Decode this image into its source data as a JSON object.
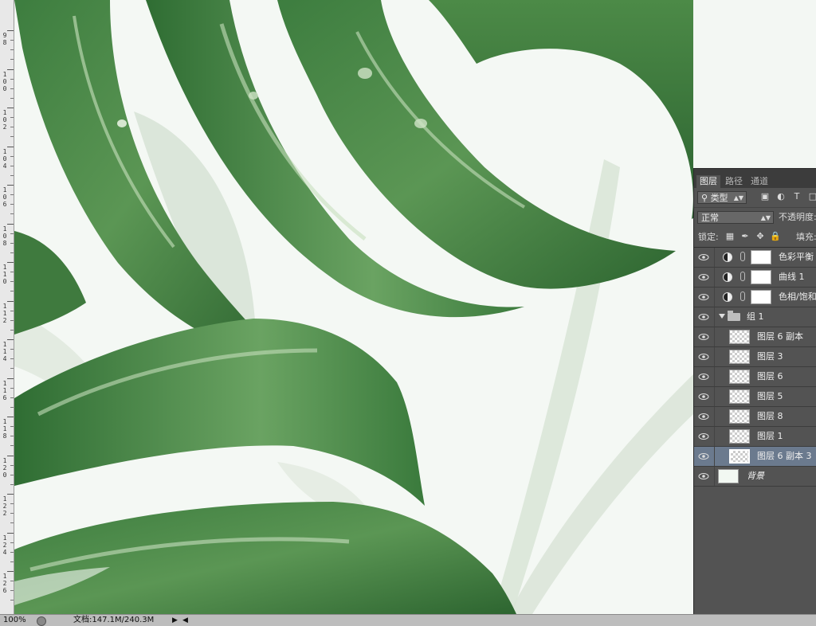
{
  "ruler": {
    "labels": [
      "98",
      "100",
      "102",
      "104",
      "106",
      "108",
      "110",
      "112",
      "114",
      "116",
      "118",
      "120",
      "122",
      "124",
      "126"
    ]
  },
  "panel": {
    "tabs": [
      "图层",
      "路径",
      "通道"
    ],
    "filter_kind": "类型",
    "filter_icons": [
      "image-icon",
      "adjustment-icon",
      "type-icon"
    ],
    "blend_mode": "正常",
    "opacity_label": "不透明度:",
    "lock_label": "锁定:",
    "fill_label": "填充:",
    "layers": [
      {
        "name": "色彩平衡",
        "kind": "adjustment",
        "selected": false
      },
      {
        "name": "曲线 1",
        "kind": "adjustment",
        "selected": false
      },
      {
        "name": "色相/饱和",
        "kind": "adjustment",
        "selected": false
      },
      {
        "name": "组 1",
        "kind": "group",
        "selected": false
      },
      {
        "name": "图层 6 副本",
        "kind": "pixel",
        "selected": false
      },
      {
        "name": "图层 3",
        "kind": "pixel",
        "selected": false
      },
      {
        "name": "图层 6",
        "kind": "pixel",
        "selected": false
      },
      {
        "name": "图层 5",
        "kind": "pixel",
        "selected": false
      },
      {
        "name": "图层 8",
        "kind": "pixel",
        "selected": false
      },
      {
        "name": "图层 1",
        "kind": "pixel",
        "selected": false
      },
      {
        "name": "图层 6 副本 3",
        "kind": "pixel",
        "selected": true
      },
      {
        "name": "背景",
        "kind": "background",
        "selected": false
      }
    ]
  },
  "status": {
    "zoom": "100%",
    "doc_info": "文档:147.1M/240.3M"
  },
  "colors": {
    "leaf_dark": "#2f6b35",
    "leaf_mid": "#4f8a4a",
    "leaf_light": "#8fbf86",
    "background": "#f4f8f4",
    "panel_bg": "#535353",
    "selected_row": "#6b7a8e"
  }
}
